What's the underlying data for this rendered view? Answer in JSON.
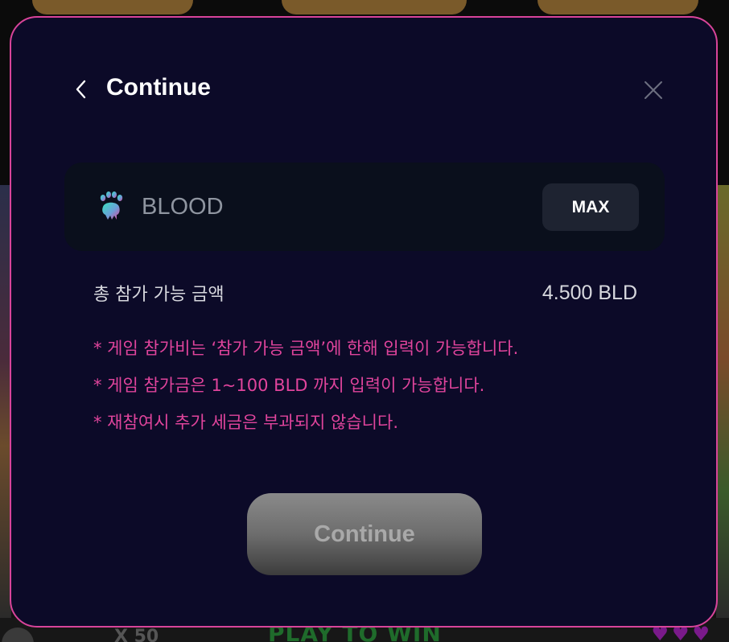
{
  "background": {
    "bottom_multiplier": "X 50",
    "bottom_banner": "PLAY TO WIN"
  },
  "modal": {
    "title": "Continue",
    "back_icon": "chevron-left-icon",
    "close_icon": "close-icon",
    "token": {
      "icon": "paw-token-icon",
      "placeholder": "BLOOD",
      "value": "",
      "max_label": "MAX"
    },
    "amount": {
      "label": "총 참가 가능 금액",
      "value": "4.500 BLD"
    },
    "notes": [
      "* 게임 참가비는 ‘참가 가능 금액’에 한해 입력이 가능합니다.",
      "* 게임 참가금은 1~100 BLD 까지 입력이 가능합니다.",
      "* 재참여시 추가 세금은 부과되지 않습니다."
    ],
    "continue_label": "Continue",
    "colors": {
      "background": "#0c0a28",
      "border": "#d8449a",
      "note_text": "#e0449c",
      "field_bg": "#0a0f1c",
      "max_bg": "#1e2331"
    }
  }
}
